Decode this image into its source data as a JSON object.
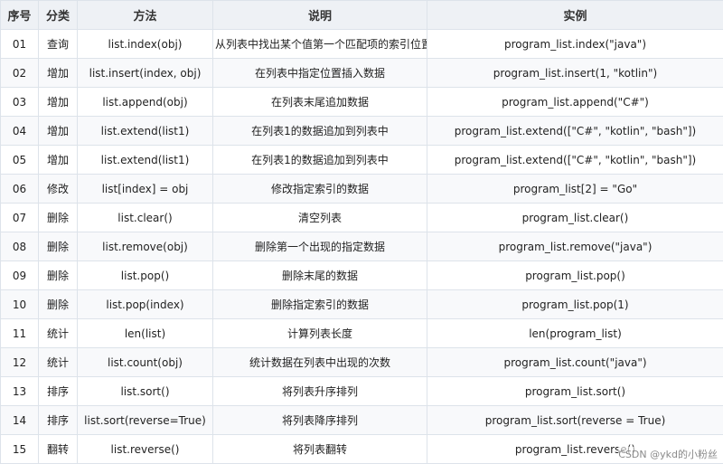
{
  "table": {
    "headers": [
      "序号",
      "分类",
      "方法",
      "说明",
      "实例"
    ],
    "rows": [
      [
        "01",
        "查询",
        "list.index(obj)",
        "从列表中找出某个值第一个匹配项的索引位置",
        "program_list.index(\"java\")"
      ],
      [
        "02",
        "增加",
        "list.insert(index, obj)",
        "在列表中指定位置插入数据",
        "program_list.insert(1, \"kotlin\")"
      ],
      [
        "03",
        "增加",
        "list.append(obj)",
        "在列表末尾追加数据",
        "program_list.append(\"C#\")"
      ],
      [
        "04",
        "增加",
        "list.extend(list1)",
        "在列表1的数据追加到列表中",
        "program_list.extend([\"C#\", \"kotlin\", \"bash\"])"
      ],
      [
        "05",
        "增加",
        "list.extend(list1)",
        "在列表1的数据追加到列表中",
        "program_list.extend([\"C#\", \"kotlin\", \"bash\"])"
      ],
      [
        "06",
        "修改",
        "list[index] = obj",
        "修改指定索引的数据",
        "program_list[2] = \"Go\""
      ],
      [
        "07",
        "删除",
        "list.clear()",
        "清空列表",
        "program_list.clear()"
      ],
      [
        "08",
        "删除",
        "list.remove(obj)",
        "删除第一个出现的指定数据",
        "program_list.remove(\"java\")"
      ],
      [
        "09",
        "删除",
        "list.pop()",
        "删除末尾的数据",
        "program_list.pop()"
      ],
      [
        "10",
        "删除",
        "list.pop(index)",
        "删除指定索引的数据",
        "program_list.pop(1)"
      ],
      [
        "11",
        "统计",
        "len(list)",
        "计算列表长度",
        "len(program_list)"
      ],
      [
        "12",
        "统计",
        "list.count(obj)",
        "统计数据在列表中出现的次数",
        "program_list.count(\"java\")"
      ],
      [
        "13",
        "排序",
        "list.sort()",
        "将列表升序排列",
        "program_list.sort()"
      ],
      [
        "14",
        "排序",
        "list.sort(reverse=True)",
        "将列表降序排列",
        "program_list.sort(reverse = True)"
      ],
      [
        "15",
        "翻转",
        "list.reverse()",
        "将列表翻转",
        "program_list.reverse()"
      ]
    ]
  },
  "watermark": "CSDN @ykd的小粉丝"
}
